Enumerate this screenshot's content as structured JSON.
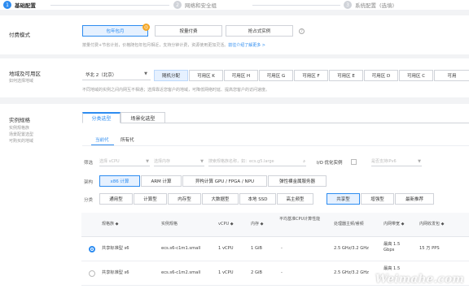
{
  "steps": [
    {
      "num": "1",
      "label": "基础配置"
    },
    {
      "num": "2",
      "label": "网络和安全组"
    },
    {
      "num": "3",
      "label": "系统配置",
      "note": "(选填)"
    }
  ],
  "billing": {
    "title": "付费模式",
    "options": [
      "包年包月",
      "按量付费",
      "抢占式实例"
    ],
    "selected": "包年包月",
    "hint": "按量付费+节省计划，价格随包年包月相近，支持分钟计费，资源使用更加灵活。",
    "hint_link": "前往介绍了解更多 >"
  },
  "region": {
    "title": "地域及可用区",
    "subtitle": "如何选择地域",
    "select_value": "华北 2（北京）",
    "zones": [
      "随机分配",
      "可用区 K",
      "可用区 H",
      "可用区 G",
      "可用区 F",
      "可用区 E",
      "可用区 D",
      "可用区 C",
      "可用"
    ],
    "selected_zone": "随机分配",
    "hint": "不同地域的实例之间内网互不相通；选择靠近您客户的地域，可降低网络时延、提高您客户的访问速度。"
  },
  "instance": {
    "title": "实例规格",
    "links": [
      "实例规格族",
      "场景配置选型",
      "可购买的地域"
    ],
    "tabs": [
      "分类选型",
      "场景化选型"
    ],
    "subtabs": [
      "当前代",
      "所有代"
    ],
    "filter_label": "筛选",
    "filters": {
      "vcpu": "选择 vCPU",
      "mem": "选择内存",
      "search": "搜索规格族名称，如：ecs.g5.large",
      "io_label": "I/O 优化实例",
      "ipv6": "是否支持IPv6"
    },
    "arch_label": "架构",
    "arch": [
      "x86 计算",
      "ARM 计算",
      "异构计算 GPU / FPGA / NPU",
      "弹性裸金属服务器"
    ],
    "arch_selected": "x86 计算",
    "cat_label": "分类",
    "categories": [
      "通用型",
      "计算型",
      "内存型",
      "大数据型",
      "本地 SSD",
      "高主频型",
      "共享型",
      "增强型",
      "最新推荐"
    ],
    "cat_selected": "共享型",
    "table": {
      "headers": [
        "规格族",
        "实例规格",
        "vCPU",
        "内存",
        "平均基准CPU计算性能",
        "处理器主频/睿频",
        "内网带宽",
        "内网收发包"
      ],
      "sort_glyph": "◆",
      "rows": [
        {
          "family": "共享标准型 s6",
          "spec": "ecs.s6-c1m1.small",
          "vcpu": "1 vCPU",
          "mem": "1 GiB",
          "perf": "-",
          "freq": "2.5 GHz/3.2 GHz",
          "bw": "最高 1.5 Gbps",
          "pps": "15 万 PPS",
          "selected": true
        },
        {
          "family": "共享标准型 s6",
          "spec": "ecs.s6-c1m2.small",
          "vcpu": "1 vCPU",
          "mem": "2 GiB",
          "perf": "-",
          "freq": "2.5 GHz/3.2 GHz",
          "bw": "最高 1.5",
          "pps": "",
          "selected": false
        }
      ]
    }
  },
  "watermark": "Weimahe.com",
  "colors": {
    "accent": "#2d8cf0",
    "badge": "#f5a623"
  }
}
